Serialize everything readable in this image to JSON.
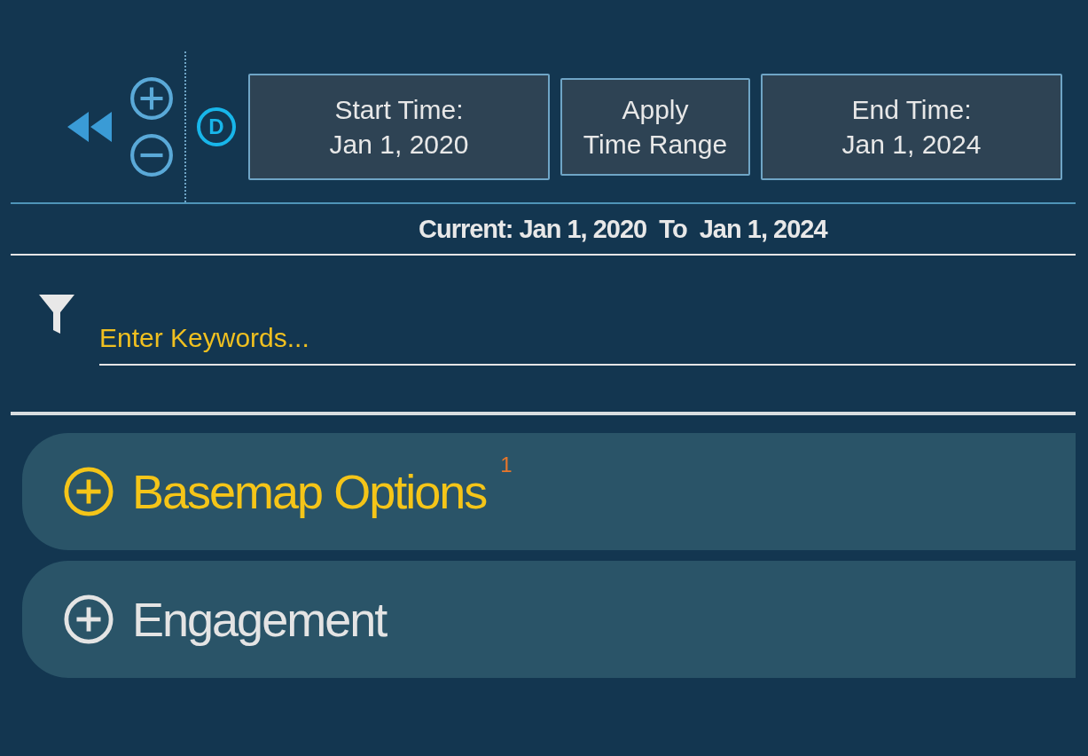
{
  "time_controls": {
    "mode": "D",
    "start_button": [
      "Start Time:",
      "Jan 1, 2020"
    ],
    "apply_button": [
      "Apply",
      "Time Range"
    ],
    "end_button": [
      "End Time:",
      "Jan 1, 2024"
    ]
  },
  "current_range": {
    "label": "Current:",
    "start": "Jan 1, 2020",
    "separator": "To",
    "end": "Jan 1, 2024"
  },
  "search": {
    "placeholder": "Enter Keywords..."
  },
  "panels": [
    {
      "title": "Basemap Options",
      "badge": "1",
      "highlighted": true,
      "expanded": false
    },
    {
      "title": "Engagement",
      "highlighted": false,
      "expanded": false
    }
  ]
}
